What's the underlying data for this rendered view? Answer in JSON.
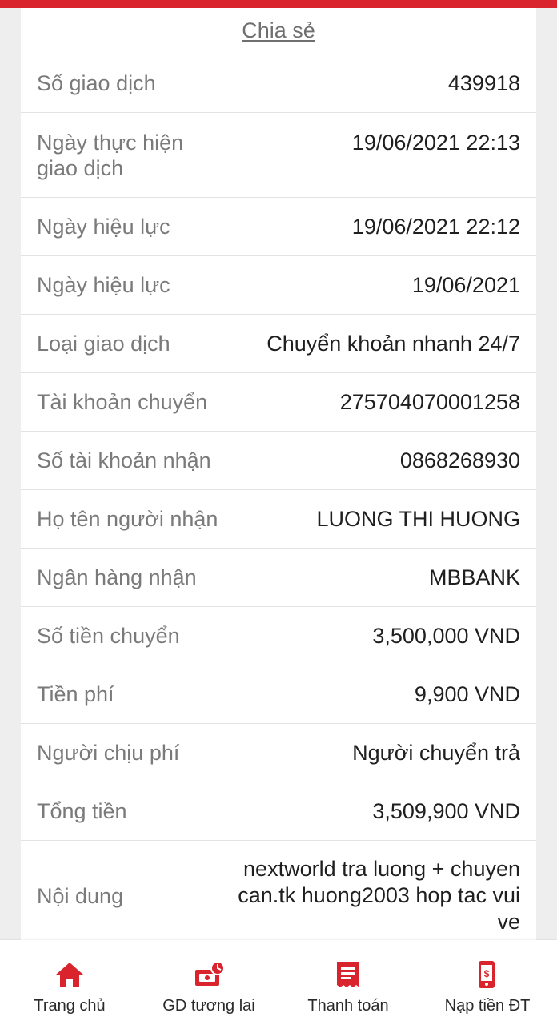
{
  "share_label": "Chia sẻ",
  "details": [
    {
      "label": "Số giao dịch",
      "value": "439918"
    },
    {
      "label": "Ngày thực hiện giao dịch",
      "value": "19/06/2021 22:13"
    },
    {
      "label": "Ngày hiệu lực",
      "value": "19/06/2021 22:12"
    },
    {
      "label": "Ngày hiệu lực",
      "value": "19/06/2021"
    },
    {
      "label": "Loại giao dịch",
      "value": "Chuyển khoản nhanh 24/7"
    },
    {
      "label": "Tài khoản chuyển",
      "value": "275704070001258"
    },
    {
      "label": "Số tài khoản nhận",
      "value": "0868268930"
    },
    {
      "label": "Họ tên người nhận",
      "value": "LUONG THI HUONG"
    },
    {
      "label": "Ngân hàng nhận",
      "value": "MBBANK"
    },
    {
      "label": "Số tiền chuyển",
      "value": "3,500,000 VND"
    },
    {
      "label": "Tiền phí",
      "value": "9,900 VND"
    },
    {
      "label": "Người chịu phí",
      "value": "Người chuyển trả"
    },
    {
      "label": "Tổng tiền",
      "value": "3,509,900 VND"
    },
    {
      "label": "Nội dung",
      "value": "nextworld tra luong + chuyen can.tk huong2003 hop tac vui ve"
    }
  ],
  "nav": [
    {
      "label": "Trang chủ",
      "icon": "home-icon"
    },
    {
      "label": "GD tương lai",
      "icon": "scheduled-payment-icon"
    },
    {
      "label": "Thanh toán",
      "icon": "bill-icon"
    },
    {
      "label": "Nạp tiền ĐT",
      "icon": "phone-topup-icon"
    }
  ],
  "colors": {
    "accent": "#d9232d",
    "label": "#7a7a7a",
    "value": "#1f1f1f"
  }
}
